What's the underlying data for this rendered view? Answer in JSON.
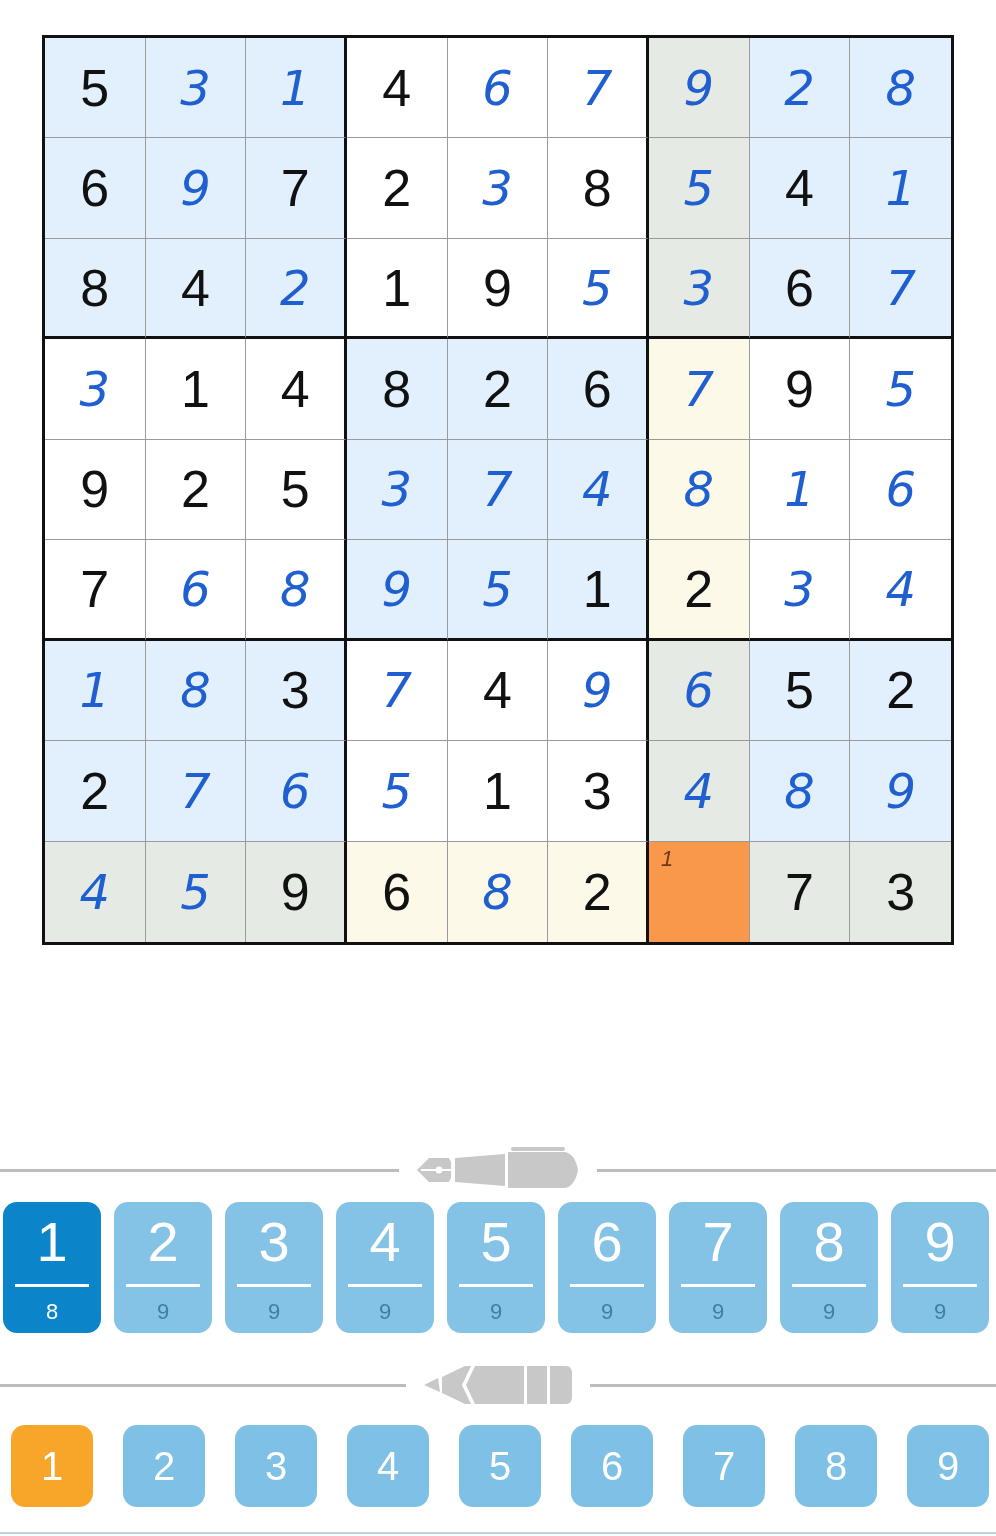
{
  "grid": [
    [
      {
        "v": "5",
        "given": true,
        "color": "#e1f0fc"
      },
      {
        "v": "3",
        "given": false,
        "color": "#e1f0fc"
      },
      {
        "v": "1",
        "given": false,
        "color": "#e1f0fc"
      },
      {
        "v": "4",
        "given": true,
        "color": "#ffffff"
      },
      {
        "v": "6",
        "given": false,
        "color": "#ffffff"
      },
      {
        "v": "7",
        "given": false,
        "color": "#ffffff"
      },
      {
        "v": "9",
        "given": false,
        "color": "#e5ebe4"
      },
      {
        "v": "2",
        "given": false,
        "color": "#e1f0fc"
      },
      {
        "v": "8",
        "given": false,
        "color": "#e1f0fc"
      }
    ],
    [
      {
        "v": "6",
        "given": true,
        "color": "#e1f0fc"
      },
      {
        "v": "9",
        "given": false,
        "color": "#e1f0fc"
      },
      {
        "v": "7",
        "given": true,
        "color": "#e1f0fc"
      },
      {
        "v": "2",
        "given": true,
        "color": "#ffffff"
      },
      {
        "v": "3",
        "given": false,
        "color": "#ffffff"
      },
      {
        "v": "8",
        "given": true,
        "color": "#ffffff"
      },
      {
        "v": "5",
        "given": false,
        "color": "#e5ebe4"
      },
      {
        "v": "4",
        "given": true,
        "color": "#e1f0fc"
      },
      {
        "v": "1",
        "given": false,
        "color": "#e1f0fc"
      }
    ],
    [
      {
        "v": "8",
        "given": true,
        "color": "#e1f0fc"
      },
      {
        "v": "4",
        "given": true,
        "color": "#e1f0fc"
      },
      {
        "v": "2",
        "given": false,
        "color": "#e1f0fc"
      },
      {
        "v": "1",
        "given": true,
        "color": "#ffffff"
      },
      {
        "v": "9",
        "given": true,
        "color": "#ffffff"
      },
      {
        "v": "5",
        "given": false,
        "color": "#ffffff"
      },
      {
        "v": "3",
        "given": false,
        "color": "#e5ebe4"
      },
      {
        "v": "6",
        "given": true,
        "color": "#e1f0fc"
      },
      {
        "v": "7",
        "given": false,
        "color": "#e1f0fc"
      }
    ],
    [
      {
        "v": "3",
        "given": false,
        "color": "#ffffff"
      },
      {
        "v": "1",
        "given": true,
        "color": "#ffffff"
      },
      {
        "v": "4",
        "given": true,
        "color": "#ffffff"
      },
      {
        "v": "8",
        "given": true,
        "color": "#e1f0fc"
      },
      {
        "v": "2",
        "given": true,
        "color": "#e1f0fc"
      },
      {
        "v": "6",
        "given": true,
        "color": "#e1f0fc"
      },
      {
        "v": "7",
        "given": false,
        "color": "#fdf9e9"
      },
      {
        "v": "9",
        "given": true,
        "color": "#ffffff"
      },
      {
        "v": "5",
        "given": false,
        "color": "#ffffff"
      }
    ],
    [
      {
        "v": "9",
        "given": true,
        "color": "#ffffff"
      },
      {
        "v": "2",
        "given": true,
        "color": "#ffffff"
      },
      {
        "v": "5",
        "given": true,
        "color": "#ffffff"
      },
      {
        "v": "3",
        "given": false,
        "color": "#e1f0fc"
      },
      {
        "v": "7",
        "given": false,
        "color": "#e1f0fc"
      },
      {
        "v": "4",
        "given": false,
        "color": "#e1f0fc"
      },
      {
        "v": "8",
        "given": false,
        "color": "#fdf9e9"
      },
      {
        "v": "1",
        "given": false,
        "color": "#ffffff"
      },
      {
        "v": "6",
        "given": false,
        "color": "#ffffff"
      }
    ],
    [
      {
        "v": "7",
        "given": true,
        "color": "#ffffff"
      },
      {
        "v": "6",
        "given": false,
        "color": "#ffffff"
      },
      {
        "v": "8",
        "given": false,
        "color": "#ffffff"
      },
      {
        "v": "9",
        "given": false,
        "color": "#e1f0fc"
      },
      {
        "v": "5",
        "given": false,
        "color": "#e1f0fc"
      },
      {
        "v": "1",
        "given": true,
        "color": "#e1f0fc"
      },
      {
        "v": "2",
        "given": true,
        "color": "#fdf9e9"
      },
      {
        "v": "3",
        "given": false,
        "color": "#ffffff"
      },
      {
        "v": "4",
        "given": false,
        "color": "#ffffff"
      }
    ],
    [
      {
        "v": "1",
        "given": false,
        "color": "#e1f0fc"
      },
      {
        "v": "8",
        "given": false,
        "color": "#e1f0fc"
      },
      {
        "v": "3",
        "given": true,
        "color": "#e1f0fc"
      },
      {
        "v": "7",
        "given": false,
        "color": "#ffffff"
      },
      {
        "v": "4",
        "given": true,
        "color": "#ffffff"
      },
      {
        "v": "9",
        "given": false,
        "color": "#ffffff"
      },
      {
        "v": "6",
        "given": false,
        "color": "#e5ebe4"
      },
      {
        "v": "5",
        "given": true,
        "color": "#e1f0fc"
      },
      {
        "v": "2",
        "given": true,
        "color": "#e1f0fc"
      }
    ],
    [
      {
        "v": "2",
        "given": true,
        "color": "#e1f0fc"
      },
      {
        "v": "7",
        "given": false,
        "color": "#e1f0fc"
      },
      {
        "v": "6",
        "given": false,
        "color": "#e1f0fc"
      },
      {
        "v": "5",
        "given": false,
        "color": "#ffffff"
      },
      {
        "v": "1",
        "given": true,
        "color": "#ffffff"
      },
      {
        "v": "3",
        "given": true,
        "color": "#ffffff"
      },
      {
        "v": "4",
        "given": false,
        "color": "#e5ebe4"
      },
      {
        "v": "8",
        "given": false,
        "color": "#e1f0fc"
      },
      {
        "v": "9",
        "given": false,
        "color": "#e1f0fc"
      }
    ],
    [
      {
        "v": "4",
        "given": false,
        "color": "#e5ebe4"
      },
      {
        "v": "5",
        "given": false,
        "color": "#e5ebe4"
      },
      {
        "v": "9",
        "given": true,
        "color": "#e5ebe4"
      },
      {
        "v": "6",
        "given": true,
        "color": "#fdf9e9"
      },
      {
        "v": "8",
        "given": false,
        "color": "#fdf9e9"
      },
      {
        "v": "2",
        "given": true,
        "color": "#fdf9e9"
      },
      {
        "note": "1",
        "color": "#f9984a"
      },
      {
        "v": "7",
        "given": true,
        "color": "#e5ebe4"
      },
      {
        "v": "3",
        "given": true,
        "color": "#e5ebe4"
      }
    ]
  ],
  "pen_keys": [
    {
      "label": "1",
      "count": "8",
      "selected": true
    },
    {
      "label": "2",
      "count": "9",
      "selected": false
    },
    {
      "label": "3",
      "count": "9",
      "selected": false
    },
    {
      "label": "4",
      "count": "9",
      "selected": false
    },
    {
      "label": "5",
      "count": "9",
      "selected": false
    },
    {
      "label": "6",
      "count": "9",
      "selected": false
    },
    {
      "label": "7",
      "count": "9",
      "selected": false
    },
    {
      "label": "8",
      "count": "9",
      "selected": false
    },
    {
      "label": "9",
      "count": "9",
      "selected": false
    }
  ],
  "pencil_keys": [
    {
      "label": "1",
      "selected": true
    },
    {
      "label": "2",
      "selected": false
    },
    {
      "label": "3",
      "selected": false
    },
    {
      "label": "4",
      "selected": false
    },
    {
      "label": "5",
      "selected": false
    },
    {
      "label": "6",
      "selected": false
    },
    {
      "label": "7",
      "selected": false
    },
    {
      "label": "8",
      "selected": false
    },
    {
      "label": "9",
      "selected": false
    }
  ]
}
